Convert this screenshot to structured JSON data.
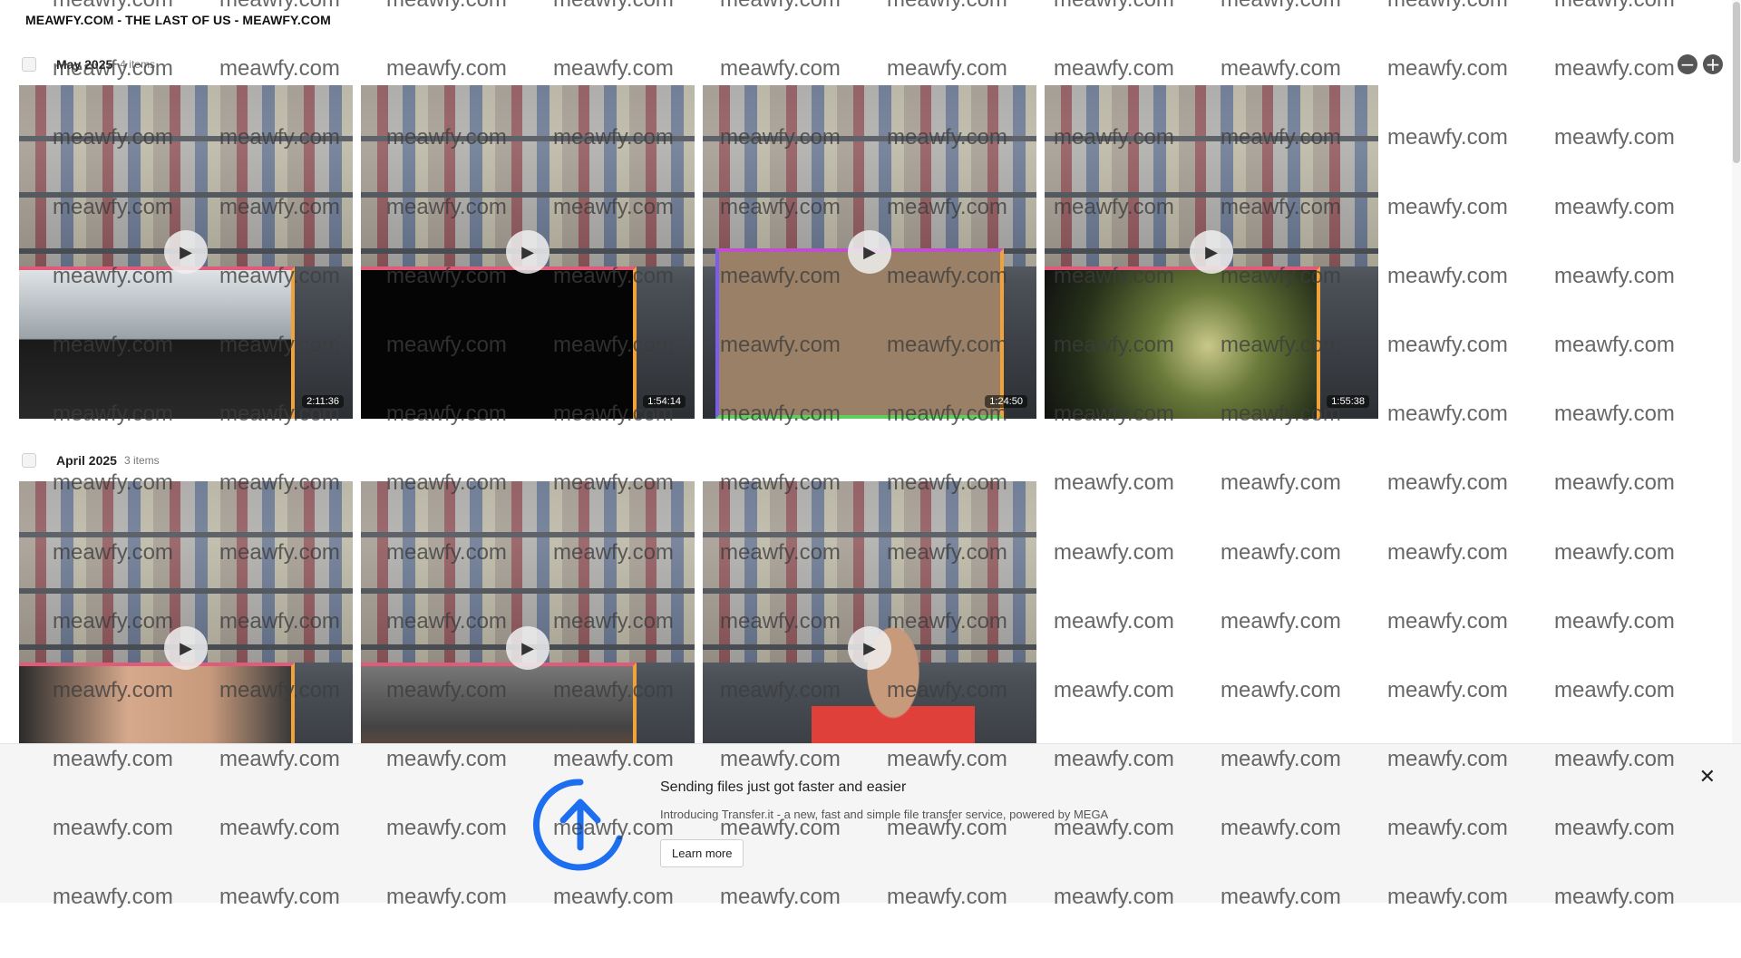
{
  "page": {
    "title": "MEAWFY.COM - THE LAST OF US - MEAWFY.COM"
  },
  "zoom": {
    "out_icon": "minus-circle-icon",
    "in_icon": "plus-circle-icon",
    "out_symbol": "−",
    "in_symbol": "+"
  },
  "sections": [
    {
      "title": "May 2025",
      "count": "4 items",
      "items": [
        {
          "duration": "2:11:36",
          "scene": "street"
        },
        {
          "duration": "1:54:14",
          "scene": "dark"
        },
        {
          "duration": "1:24:50",
          "scene": "paper"
        },
        {
          "duration": "1:55:38",
          "scene": "forest"
        }
      ]
    },
    {
      "title": "April 2025",
      "count": "3 items",
      "items": [
        {
          "duration": "",
          "scene": "face"
        },
        {
          "duration": "",
          "scene": "kid"
        },
        {
          "duration": "",
          "scene": "person"
        }
      ]
    }
  ],
  "banner": {
    "title": "Sending files just got faster and easier",
    "text": "Introducing Transfer.it - a new, fast and simple file transfer service, powered by MEGA",
    "button": "Learn more",
    "icon": "upload-arrow-icon",
    "close_icon": "close-icon",
    "close_symbol": "✕",
    "accent_color": "#1e6ff0"
  },
  "watermark": {
    "text": "meawfy.com"
  }
}
